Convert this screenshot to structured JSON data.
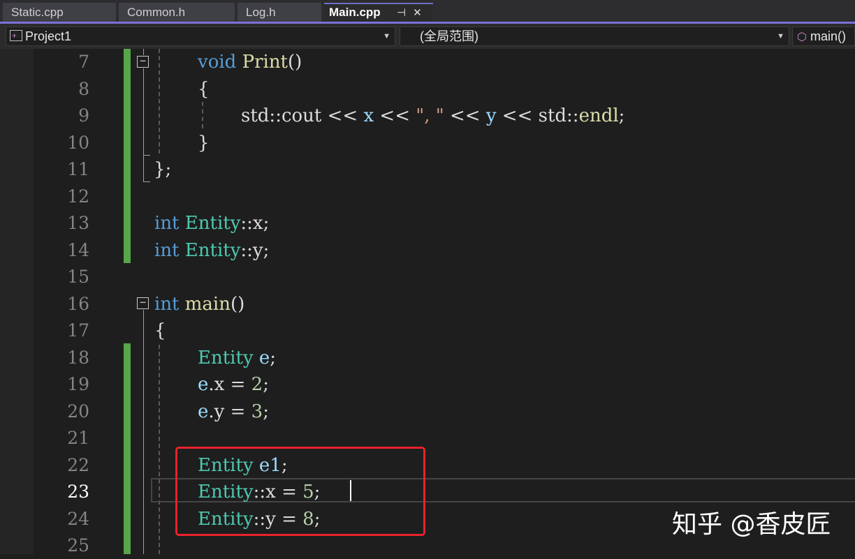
{
  "tabs": [
    {
      "label": "Static.cpp"
    },
    {
      "label": "Common.h"
    },
    {
      "label": "Log.h"
    },
    {
      "label": "Main.cpp",
      "active": true,
      "pin_icon": "⊣",
      "close_icon": "✕"
    }
  ],
  "nav": {
    "project": "Project1",
    "scope": "(全局范围)",
    "member": "main()"
  },
  "line_numbers": [
    "7",
    "8",
    "9",
    "10",
    "11",
    "12",
    "13",
    "14",
    "15",
    "16",
    "17",
    "18",
    "19",
    "20",
    "21",
    "22",
    "23",
    "24",
    "25"
  ],
  "current_line": "23",
  "code": {
    "l7": {
      "kw": "void",
      "fn": "Print",
      "tail": "()"
    },
    "l8": "{",
    "l9": {
      "a": "std::cout << ",
      "x": "x",
      "b": " << ",
      "s": "\", \"",
      "c": " << ",
      "y": "y",
      "d": " << std::",
      "e": "endl",
      "f": ";"
    },
    "l10": "}",
    "l11": "};",
    "l13": {
      "kw": "int",
      "ty": "Entity",
      "rest": "::x;"
    },
    "l14": {
      "kw": "int",
      "ty": "Entity",
      "rest": "::y;"
    },
    "l16": {
      "kw": "int",
      "fn": "main",
      "tail": "()"
    },
    "l17": "{",
    "l18": {
      "ty": "Entity",
      "var": "e",
      "tail": ";"
    },
    "l19": {
      "var": "e",
      "mid": ".x = ",
      "num": "2",
      "tail": ";"
    },
    "l20": {
      "var": "e",
      "mid": ".y = ",
      "num": "3",
      "tail": ";"
    },
    "l22": {
      "ty": "Entity",
      "var": "e1",
      "tail": ";"
    },
    "l23": {
      "ty": "Entity",
      "mid": "::x = ",
      "num": "5",
      "tail": ";"
    },
    "l24": {
      "ty": "Entity",
      "mid": "::y = ",
      "num": "8",
      "tail": ";"
    }
  },
  "watermark": "知乎 @香皮匠",
  "colors": {
    "accent": "#7b71d6",
    "change_bar": "#57a64a",
    "highlight_box": "#e8222b",
    "keyword": "#569cd6",
    "type": "#4ec9b0",
    "function": "#dcdcaa",
    "number": "#b5cea8",
    "variable": "#9cdcfe"
  }
}
